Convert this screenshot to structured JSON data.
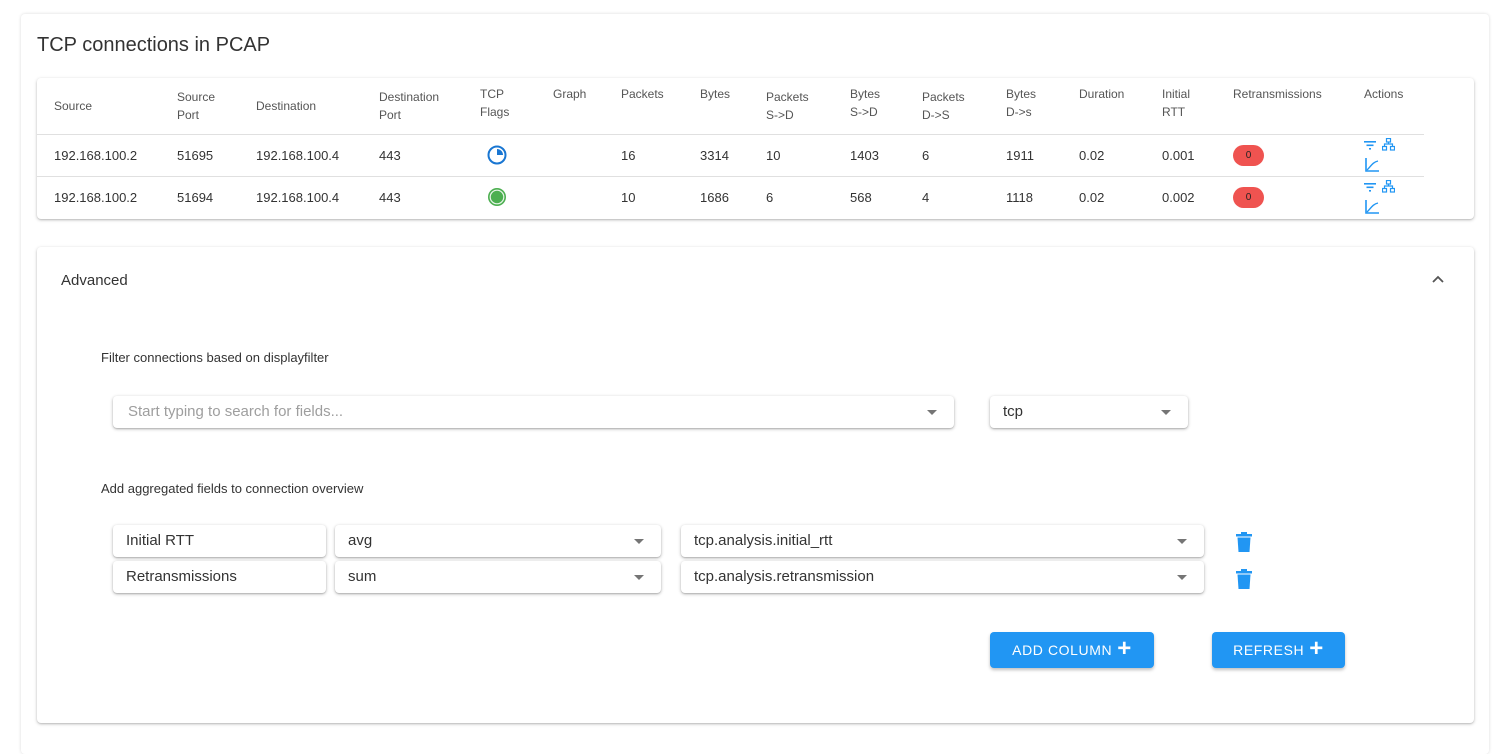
{
  "page_title": "TCP connections in PCAP",
  "table": {
    "headers": [
      [
        "Source"
      ],
      [
        "Source",
        "Port"
      ],
      [
        "Destination"
      ],
      [
        "Destination",
        "Port"
      ],
      [
        "TCP",
        "Flags"
      ],
      [
        "Graph"
      ],
      [
        "Packets"
      ],
      [
        "Bytes"
      ],
      [
        "Packets",
        "S->D"
      ],
      [
        "Bytes",
        "S->D"
      ],
      [
        "Packets",
        "D->S"
      ],
      [
        "Bytes",
        "D->s"
      ],
      [
        "Duration"
      ],
      [
        "Initial",
        "RTT"
      ],
      [
        "Retransmissions"
      ],
      [
        "Actions"
      ]
    ],
    "rows": [
      {
        "source": "192.168.100.2",
        "source_port": "51695",
        "destination": "192.168.100.4",
        "destination_port": "443",
        "tcp_flags_icon": "partial-circle-icon",
        "tcp_flags_color": "#1976d2",
        "graph": "",
        "packets": "16",
        "bytes": "3314",
        "packets_sd": "10",
        "bytes_sd": "1403",
        "packets_ds": "6",
        "bytes_ds": "1911",
        "duration": "0.02",
        "initial_rtt": "0.001",
        "retransmissions": "0"
      },
      {
        "source": "192.168.100.2",
        "source_port": "51694",
        "destination": "192.168.100.4",
        "destination_port": "443",
        "tcp_flags_icon": "full-circle-icon",
        "tcp_flags_color": "#4caf50",
        "graph": "",
        "packets": "10",
        "bytes": "1686",
        "packets_sd": "6",
        "bytes_sd": "568",
        "packets_ds": "4",
        "bytes_ds": "1118",
        "duration": "0.02",
        "initial_rtt": "0.002",
        "retransmissions": "0"
      }
    ],
    "actions": [
      "filter-icon",
      "sitemap-icon",
      "chart-line-icon"
    ]
  },
  "advanced": {
    "title": "Advanced",
    "filter_label": "Filter connections based on displayfilter",
    "field_search": {
      "placeholder": "Start typing to search for fields...",
      "value": ""
    },
    "protocol_select": {
      "value": "tcp"
    },
    "aggregate_label": "Add aggregated fields to connection overview",
    "aggregates": [
      {
        "name": "Initial RTT",
        "function": "avg",
        "field": "tcp.analysis.initial_rtt"
      },
      {
        "name": "Retransmissions",
        "function": "sum",
        "field": "tcp.analysis.retransmission"
      }
    ],
    "add_column_label": "ADD COLUMN",
    "refresh_label": "REFRESH"
  },
  "colors": {
    "accent": "#2196f3",
    "badge_red": "#ef5350",
    "flag_blue": "#1976d2",
    "flag_green": "#4caf50"
  }
}
